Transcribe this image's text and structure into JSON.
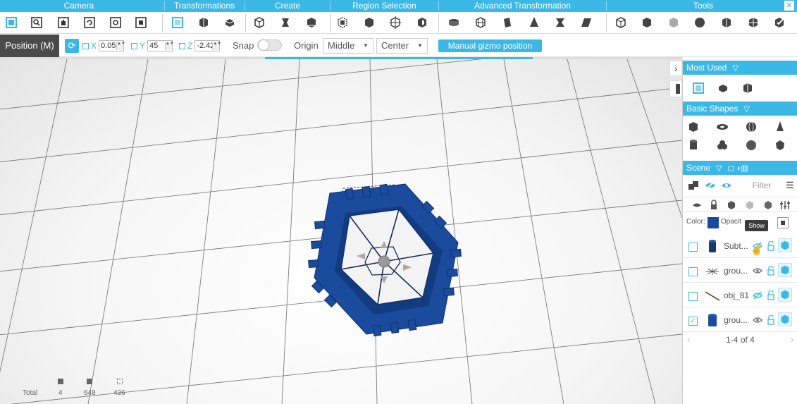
{
  "toolbar": {
    "categories": [
      "Camera",
      "Transformations",
      "Create",
      "Region Selection",
      "Advanced Transformation",
      "Tools"
    ],
    "close_label": "✕"
  },
  "position_bar": {
    "mode_label": "Position (M)",
    "x_label": "X",
    "x_value": "0.05",
    "y_label": "Y",
    "y_value": "45",
    "z_label": "Z",
    "z_value": "-2.42",
    "snap_label": "Snap",
    "snap_on": false,
    "origin_label": "Origin",
    "origin_value": "Middle",
    "center_value": "Center",
    "manual_gizmo_label": "Manual gizmo position"
  },
  "viewport": {
    "stats": {
      "total_label": "Total",
      "objects": "4",
      "vertices": "648",
      "faces": "436"
    },
    "model_color": "#1a4b9c"
  },
  "right_panel": {
    "most_used_label": "Most Used",
    "basic_shapes_label": "Basic Shapes",
    "scene_label": "Scene",
    "filter_placeholder": "Filter",
    "color_label": "Color:",
    "opacity_label": "Opacit",
    "tooltip": "Show",
    "accent_color": "#3cb8e6",
    "rows": [
      {
        "name": "Subt...",
        "checked": false,
        "icon": "cylinder-icon"
      },
      {
        "name": "grou...",
        "checked": false,
        "icon": "spark-icon"
      },
      {
        "name": "obj_81",
        "checked": false,
        "icon": "line-icon"
      },
      {
        "name": "grou...",
        "checked": true,
        "icon": "cylinder-icon"
      }
    ],
    "pager": "1-4 of 4"
  }
}
